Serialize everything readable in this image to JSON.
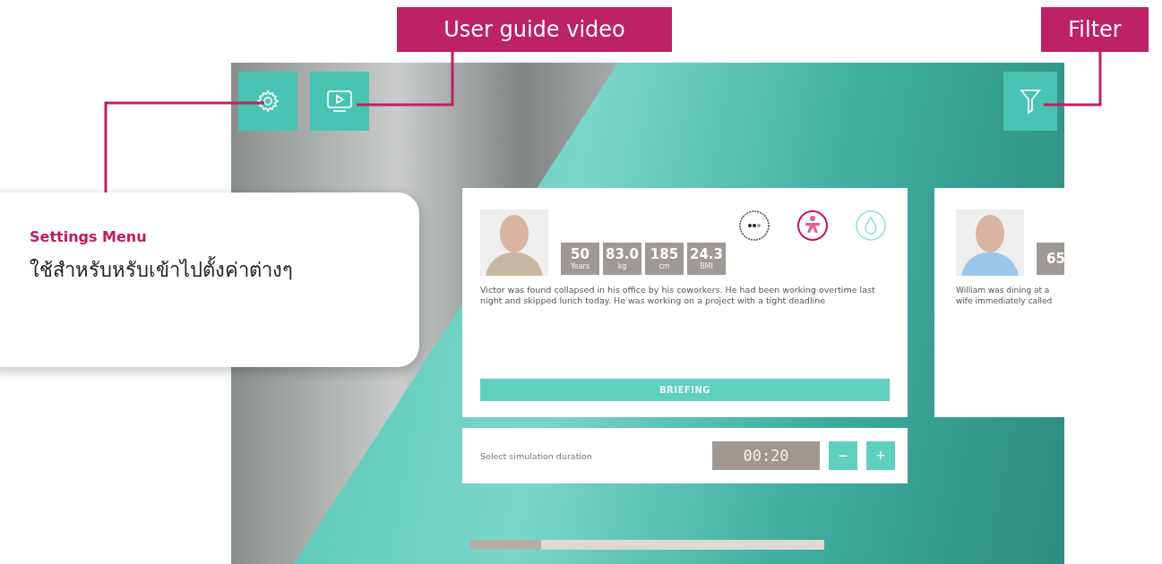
{
  "callouts": [
    {
      "kind": "tag",
      "label": "User guide video"
    },
    {
      "kind": "tag",
      "label": "Filter"
    },
    {
      "kind": "note",
      "title": "Settings Menu",
      "text": "ใช้สำหรับหรับเข้าไปตั้งค่าต่างๆ"
    }
  ],
  "toolbar": {
    "buttons": [
      {
        "kind": "settings"
      },
      {
        "kind": "video"
      },
      {
        "kind": "filter"
      }
    ]
  },
  "patients": [
    {
      "stats": [
        {
          "value": "50",
          "unit": "Years"
        },
        {
          "value": "83.0",
          "unit": "kg"
        },
        {
          "value": "185",
          "unit": "cm"
        },
        {
          "value": "24.3",
          "unit": "BMI"
        }
      ],
      "description": "Victor was found collapsed in his office by his coworkers. He had been working overtime last night and skipped lunch today. He was working on a project with a tight deadline",
      "button": "BRIEFING",
      "kind": "full"
    },
    {
      "kind": "partial",
      "stats": [
        {
          "value": "65"
        }
      ],
      "lines": [
        "William was dining at a",
        "wife immediately called"
      ]
    }
  ],
  "duration": {
    "label": "Select simulation duration",
    "value": "00:20",
    "minus": "−",
    "plus": "+"
  },
  "progress": {
    "level": 0.2
  }
}
